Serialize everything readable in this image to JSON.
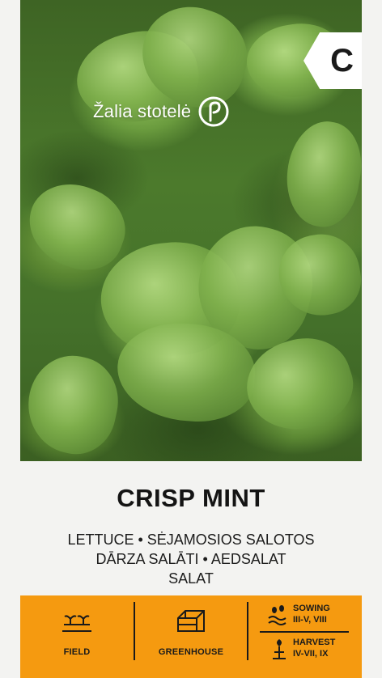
{
  "brand": {
    "name": "Žalia stotelė",
    "logo_icon": "leaf-circle-icon"
  },
  "category_badge": "C",
  "product": {
    "title": "CRISP MINT",
    "subtitle_lines": [
      "LETTUCE • SĖJAMOSIOS SALOTOS",
      "DĀRZA SALĀTI • AEDSALAT",
      "SALAT"
    ]
  },
  "info_bar": {
    "accent_color": "#f59a10",
    "field": {
      "label": "FIELD",
      "icon": "field-sprout-icon"
    },
    "greenhouse": {
      "label": "GREENHOUSE",
      "icon": "greenhouse-icon"
    },
    "sowing": {
      "label": "SOWING",
      "months": "III-V, VIII",
      "icon": "sowing-seeds-icon"
    },
    "harvest": {
      "label": "HARVEST",
      "months": "IV-VII, IX",
      "icon": "harvest-plant-icon"
    }
  }
}
